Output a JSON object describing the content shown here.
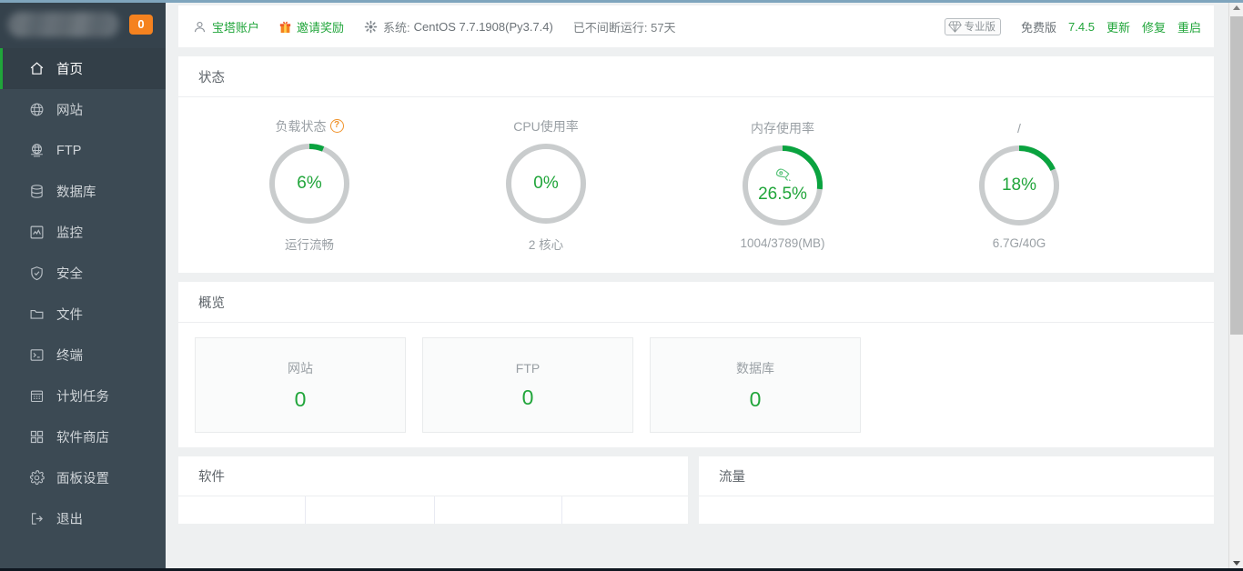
{
  "sidebar": {
    "badge_count": "0",
    "items": [
      {
        "label": "首页",
        "icon": "home-icon",
        "active": true
      },
      {
        "label": "网站",
        "icon": "globe-icon",
        "active": false
      },
      {
        "label": "FTP",
        "icon": "ftp-icon",
        "active": false
      },
      {
        "label": "数据库",
        "icon": "database-icon",
        "active": false
      },
      {
        "label": "监控",
        "icon": "chart-icon",
        "active": false
      },
      {
        "label": "安全",
        "icon": "shield-icon",
        "active": false
      },
      {
        "label": "文件",
        "icon": "folder-icon",
        "active": false
      },
      {
        "label": "终端",
        "icon": "terminal-icon",
        "active": false
      },
      {
        "label": "计划任务",
        "icon": "calendar-icon",
        "active": false
      },
      {
        "label": "软件商店",
        "icon": "grid-icon",
        "active": false
      },
      {
        "label": "面板设置",
        "icon": "gear-icon",
        "active": false
      },
      {
        "label": "退出",
        "icon": "logout-icon",
        "active": false
      }
    ]
  },
  "topbar": {
    "account_label": "宝塔账户",
    "invite_label": "邀请奖励",
    "system_label": "系统:",
    "system_value": "CentOS 7.7.1908(Py3.7.4)",
    "uptime_text": "已不间断运行: 57天",
    "pro_badge": "专业版",
    "free_label": "免费版",
    "version": "7.4.5",
    "update_label": "更新",
    "repair_label": "修复",
    "restart_label": "重启"
  },
  "status": {
    "title": "状态",
    "gauges": [
      {
        "title": "负载状态",
        "has_help": true,
        "help_glyph": "?",
        "value": "6%",
        "percent": 6,
        "sub": "运行流畅",
        "has_rocket": false
      },
      {
        "title": "CPU使用率",
        "has_help": false,
        "help_glyph": "",
        "value": "0%",
        "percent": 0,
        "sub": "2 核心",
        "has_rocket": false
      },
      {
        "title": "内存使用率",
        "has_help": false,
        "help_glyph": "",
        "value": "26.5%",
        "percent": 26.5,
        "sub": "1004/3789(MB)",
        "has_rocket": true
      },
      {
        "title": "/",
        "has_help": false,
        "help_glyph": "",
        "value": "18%",
        "percent": 18,
        "sub": "6.7G/40G",
        "has_rocket": false
      }
    ]
  },
  "overview": {
    "title": "概览",
    "boxes": [
      {
        "label": "网站",
        "count": "0"
      },
      {
        "label": "FTP",
        "count": "0"
      },
      {
        "label": "数据库",
        "count": "0"
      }
    ]
  },
  "software": {
    "title": "软件",
    "columns": [
      "",
      "",
      "",
      ""
    ]
  },
  "traffic": {
    "title": "流量"
  },
  "colors": {
    "accent_green": "#20a53a",
    "sidebar_bg": "#3c4a54",
    "sidebar_active_bg": "#333f48",
    "badge_orange": "#f5821f",
    "ring_track": "#c9cccd"
  }
}
